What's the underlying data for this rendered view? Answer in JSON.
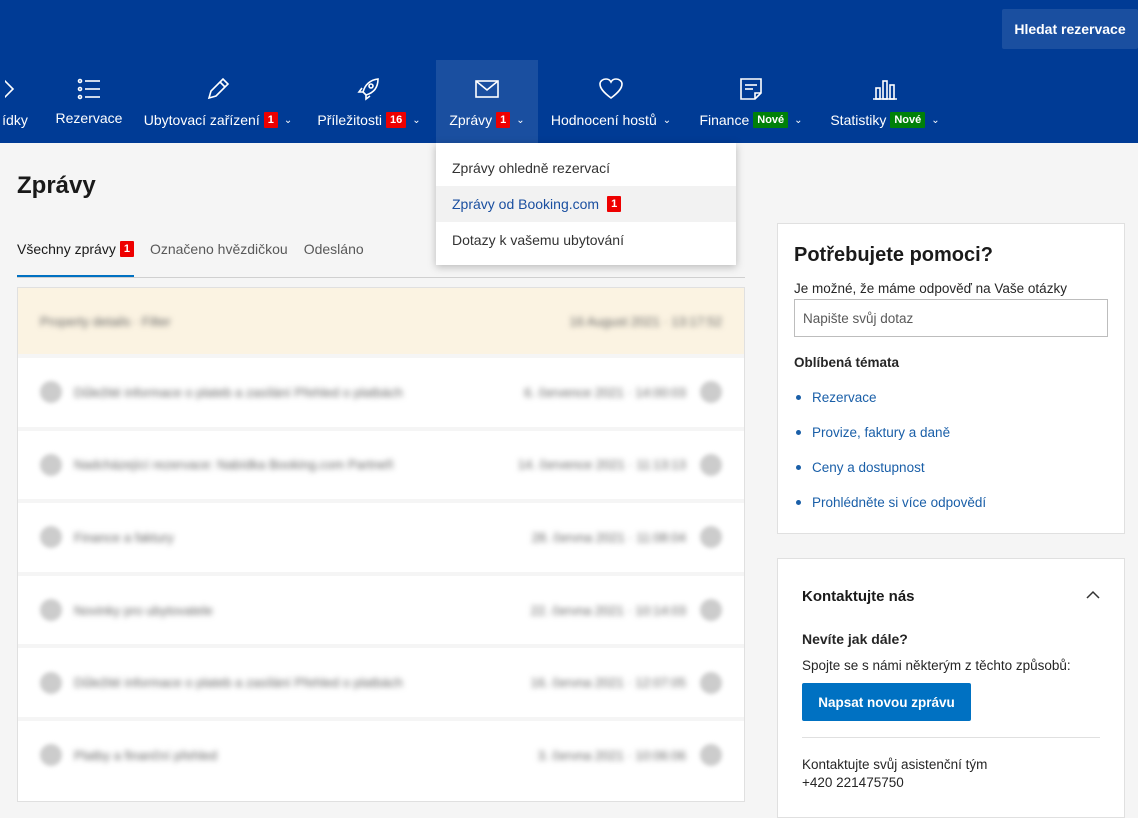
{
  "header": {
    "search_reservations": "Hledat rezervace",
    "nav": [
      {
        "label": "ídky",
        "icon": "diamond-icon"
      },
      {
        "label": "Rezervace",
        "icon": "list-icon"
      },
      {
        "label": "Ubytovací zařízení",
        "badge": "1",
        "icon": "pencil-icon"
      },
      {
        "label": "Příležitosti",
        "badge": "16",
        "icon": "rocket-icon"
      },
      {
        "label": "Zprávy",
        "badge": "1",
        "icon": "envelope-icon"
      },
      {
        "label": "Hodnocení hostů",
        "icon": "heart-icon"
      },
      {
        "label": "Finance",
        "new_badge": "Nové",
        "icon": "document-icon"
      },
      {
        "label": "Statistiky",
        "new_badge": "Nové",
        "icon": "bar-chart-icon"
      }
    ]
  },
  "dropdown": {
    "items": [
      {
        "label": "Zprávy ohledně rezervací"
      },
      {
        "label": "Zprávy od Booking.com",
        "badge": "1"
      },
      {
        "label": "Dotazy k vašemu ubytování"
      }
    ]
  },
  "main": {
    "title": "Zprávy",
    "tabs": [
      {
        "label": "Všechny zprávy",
        "badge": "1"
      },
      {
        "label": "Označeno hvězdičkou"
      },
      {
        "label": "Odesláno"
      }
    ],
    "list_header": {
      "left": "Property details · Filter",
      "right": "16 August 2021 · 13:17:52"
    },
    "rows": [
      {
        "subject": "Důležité informace o plateb a zasílání Přehled o platbách",
        "date": "6. července 2021 · 14:00:03"
      },
      {
        "subject": "Nadcházející rezervace: Nabídka Booking.com Partneři",
        "date": "14. července 2021 · 11:13:13"
      },
      {
        "subject": "Finance a faktury",
        "date": "28. června 2021 · 11:08:04"
      },
      {
        "subject": "Novinky pro ubytovatele",
        "date": "22. června 2021 · 10:14:03"
      },
      {
        "subject": "Důležité informace o plateb a zasílání Přehled o platbách",
        "date": "16. června 2021 · 12:07:05"
      },
      {
        "subject": "Platby a finanční přehled",
        "date": "3. června 2021 · 10:06:06"
      }
    ]
  },
  "help": {
    "title": "Potřebujete pomoci?",
    "subtitle": "Je možné, že máme odpověď na Vaše otázky",
    "search_placeholder": "Napište svůj dotaz",
    "favorites_title": "Oblíbená témata",
    "favorites": [
      "Rezervace",
      "Provize, faktury a daně",
      "Ceny a dostupnost",
      "Prohlédněte si více odpovědí"
    ]
  },
  "contact": {
    "title": "Kontaktujte nás",
    "question": "Nevíte jak dále?",
    "text": "Spojte se s námi některým z těchto způsobů:",
    "button": "Napsat novou zprávu",
    "team_text": "Kontaktujte svůj asistenční tým",
    "phone": "+420 221475750"
  },
  "colors": {
    "brand": "#003b95",
    "accent": "#0071c2",
    "badge": "#e00000",
    "new": "#008009"
  }
}
